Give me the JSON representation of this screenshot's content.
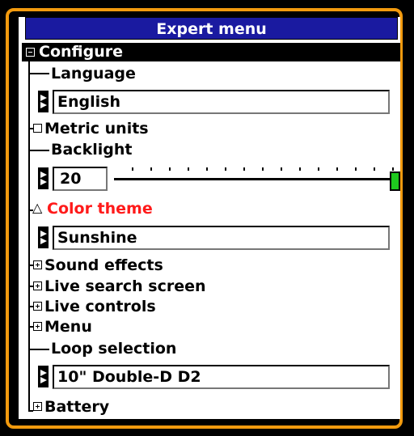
{
  "title": "Expert menu",
  "tree": {
    "configure": "Configure",
    "language_label": "Language",
    "language_value": "English",
    "metric_label": "Metric units",
    "backlight_label": "Backlight",
    "backlight_value": "20",
    "color_theme_label": "Color theme",
    "color_theme_value": "Sunshine",
    "sound_effects": "Sound effects",
    "live_search_screen": "Live search screen",
    "live_controls": "Live controls",
    "menu": "Menu",
    "loop_selection_label": "Loop selection",
    "loop_selection_value": "10\" Double-D D2",
    "battery": "Battery"
  },
  "colors": {
    "title_bar": "#1a1aa0",
    "frame": "#f29a0e",
    "highlight_text": "#ff1a1a",
    "slider_thumb": "#1ec91e"
  },
  "backlight_level": 1.0
}
